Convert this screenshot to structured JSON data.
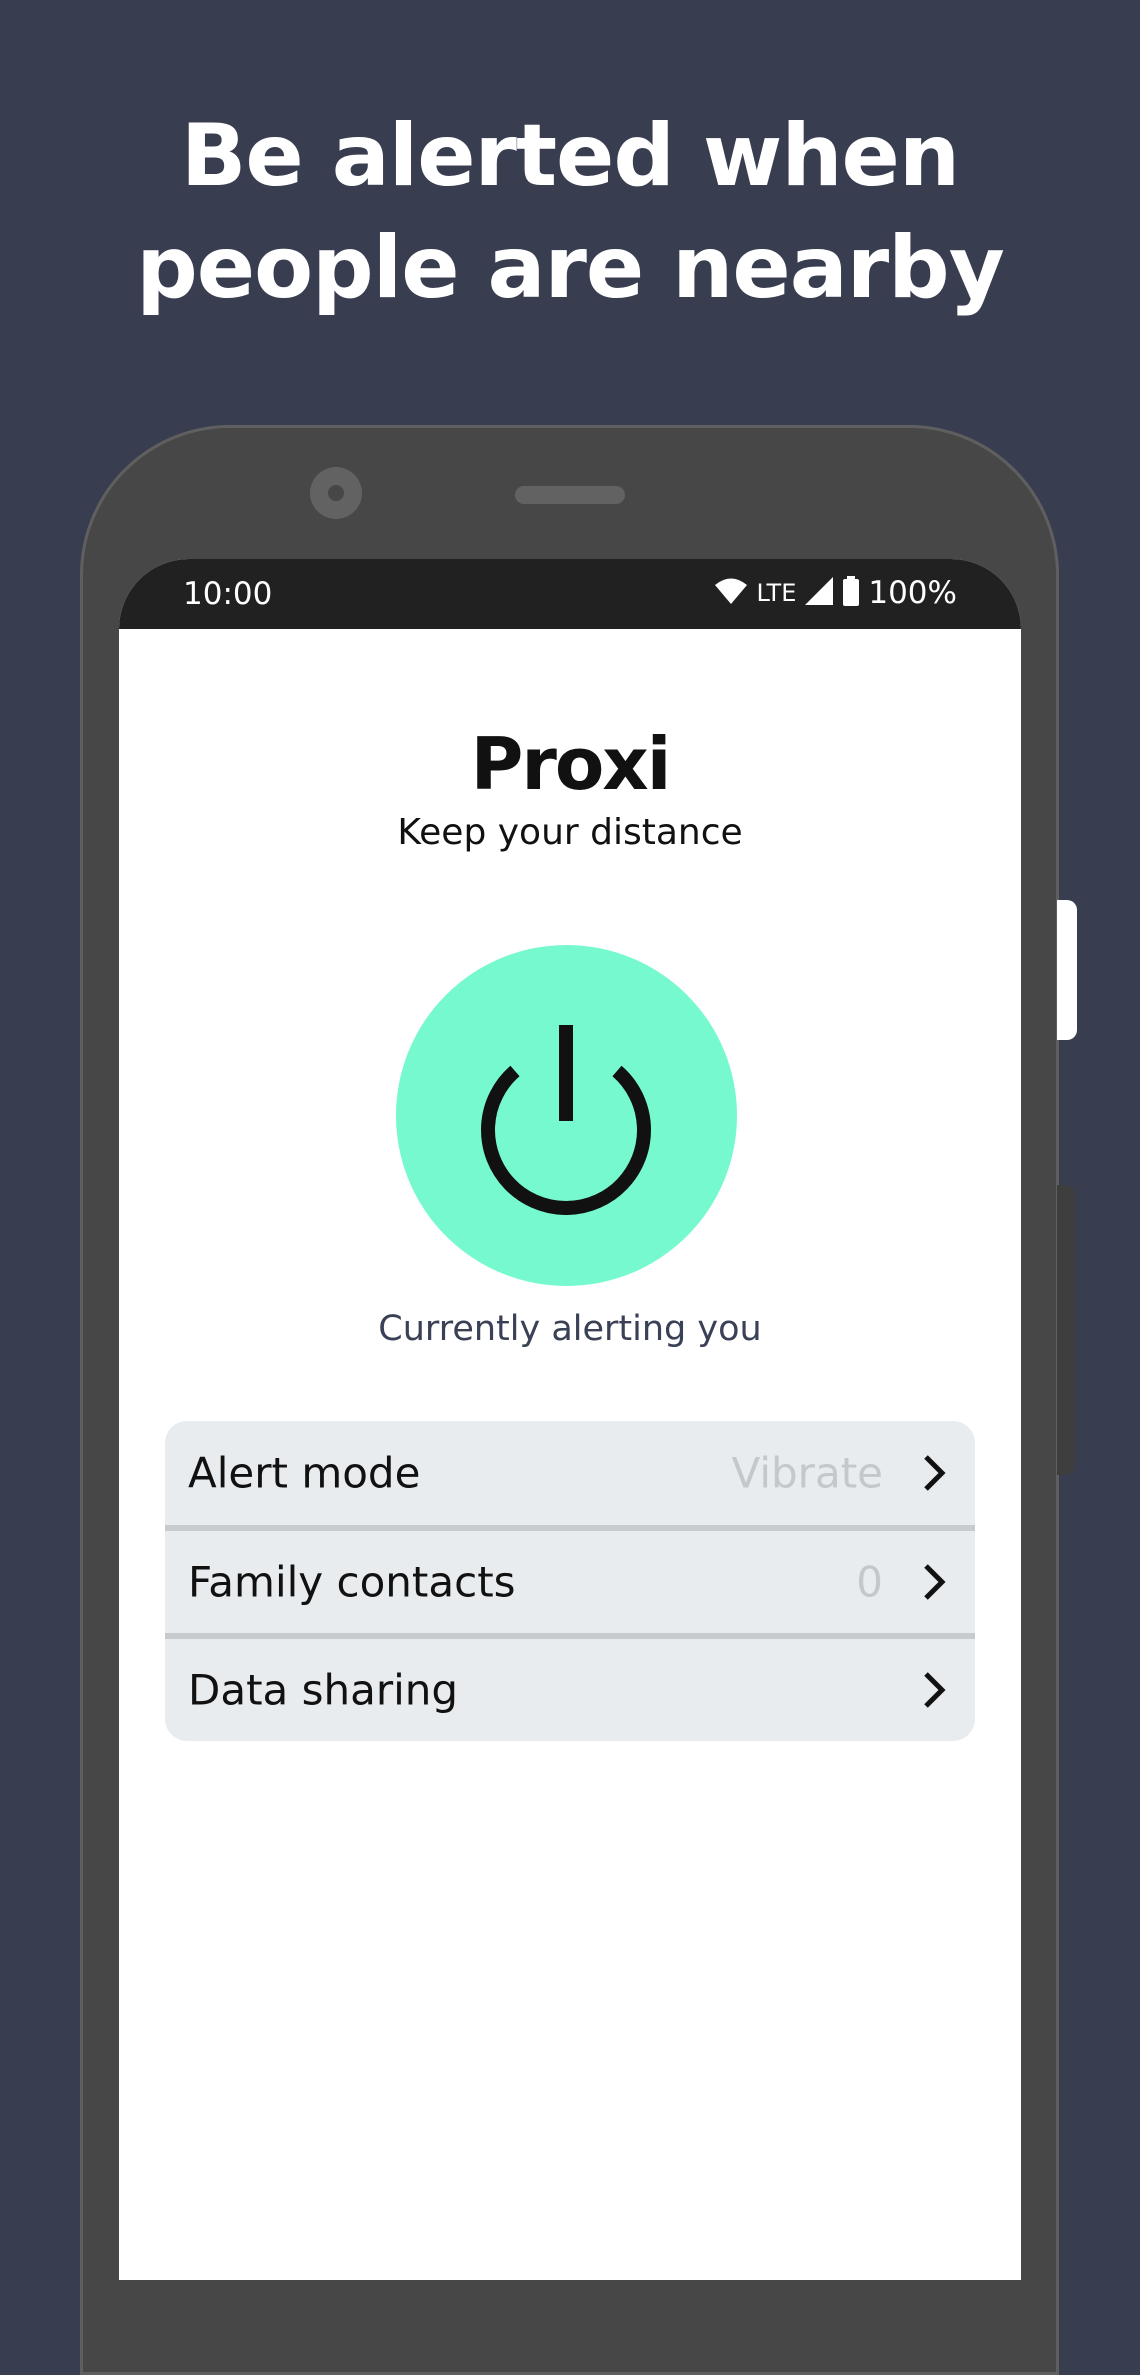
{
  "headline": {
    "line1": "Be alerted when",
    "line2": "people are nearby"
  },
  "status_bar": {
    "time": "10:00",
    "network": "LTE",
    "battery": "100%",
    "icons": [
      "wifi-icon",
      "signal-icon",
      "battery-icon"
    ]
  },
  "app": {
    "title": "Proxi",
    "subtitle": "Keep your distance",
    "power_icon": "power-icon",
    "status": "Currently alerting you",
    "accent_color": "#77f9cf"
  },
  "settings": [
    {
      "label": "Alert mode",
      "value": "Vibrate"
    },
    {
      "label": "Family contacts",
      "value": "0"
    },
    {
      "label": "Data sharing",
      "value": ""
    }
  ],
  "colors": {
    "background": "#383e50",
    "list_background": "#e8ecef",
    "value_text": "#c4c8cc"
  }
}
